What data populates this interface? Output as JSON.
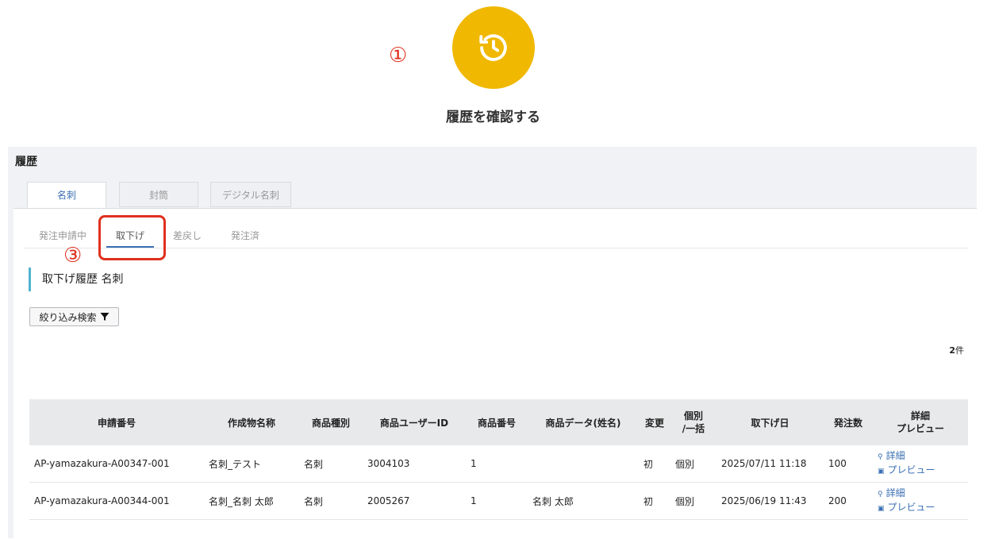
{
  "annotations": {
    "step1": "①",
    "step3": "③"
  },
  "hero": {
    "icon": "history-icon",
    "title": "履歴を確認する",
    "color": "#f0b800"
  },
  "panel": {
    "title": "履歴"
  },
  "top_tabs": [
    {
      "label": "名刺",
      "active": true
    },
    {
      "label": "封筒",
      "active": false
    },
    {
      "label": "デジタル名刺",
      "active": false
    }
  ],
  "sub_tabs": [
    {
      "label": "発注申請中"
    },
    {
      "label": "取下げ"
    },
    {
      "label": "差戻し"
    },
    {
      "label": "発注済"
    }
  ],
  "section_heading": "取下げ履歴 名刺",
  "filter_button": {
    "label": "絞り込み検索",
    "icon": "filter-icon"
  },
  "count": {
    "number": "2",
    "unit": "件"
  },
  "table": {
    "headers": [
      "申請番号",
      "作成物名称",
      "商品種別",
      "商品ユーザーID",
      "商品番号",
      "商品データ(姓名)",
      "変更",
      "個別\n/一括",
      "取下げ日",
      "発注数",
      "詳細\nプレビュー"
    ],
    "rows": [
      [
        "AP-yamazakura-A00347-001",
        "名刺_テスト",
        "名刺",
        "3004103",
        "1",
        "",
        "初",
        "個別",
        "2025/07/11 11:18",
        "100"
      ],
      [
        "AP-yamazakura-A00344-001",
        "名刺_名刺 太郎",
        "名刺",
        "2005267",
        "1",
        "名刺 太郎",
        "初",
        "個別",
        "2025/06/19 11:43",
        "200"
      ]
    ],
    "detail_link": "詳細",
    "preview_link": "プレビュー"
  },
  "colors": {
    "accent": "#3a6fb3",
    "annotation": "#e0301e",
    "heading_bar": "#4fb3cf"
  }
}
